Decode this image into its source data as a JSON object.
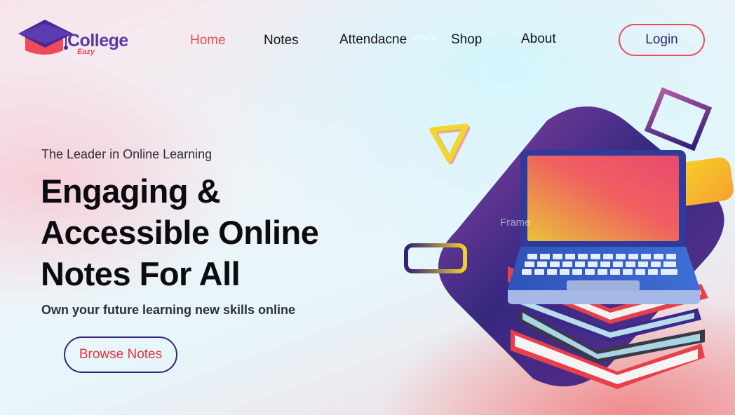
{
  "brand": {
    "name": "College",
    "tagline": "Eazy",
    "logo_icon": "graduation-cap-icon",
    "colors": {
      "primary": "#5a3aa6",
      "accent": "#ef4a5a",
      "dark": "#32287a"
    }
  },
  "nav": {
    "items": [
      {
        "label": "Home",
        "active": true
      },
      {
        "label": "Notes",
        "active": false
      },
      {
        "label": "Attendacne",
        "active": false
      },
      {
        "label": "Shop",
        "active": false
      },
      {
        "label": "About",
        "active": false
      }
    ],
    "ghost_text": "emoji",
    "login_label": "Login"
  },
  "hero": {
    "eyebrow": "The Leader in Online Learning",
    "headline_lines": [
      "Engaging &",
      "Accessible Online",
      "Notes For All"
    ],
    "subline": "Own your future learning new skills online",
    "cta_label": "Browse Notes"
  },
  "illustration": {
    "frame_label": "Frame",
    "icons": [
      "laptop-icon",
      "book-stack-icon",
      "triangle-shape-icon",
      "square-outline-icon",
      "pill-outline-icon",
      "yellow-block-icon"
    ]
  }
}
